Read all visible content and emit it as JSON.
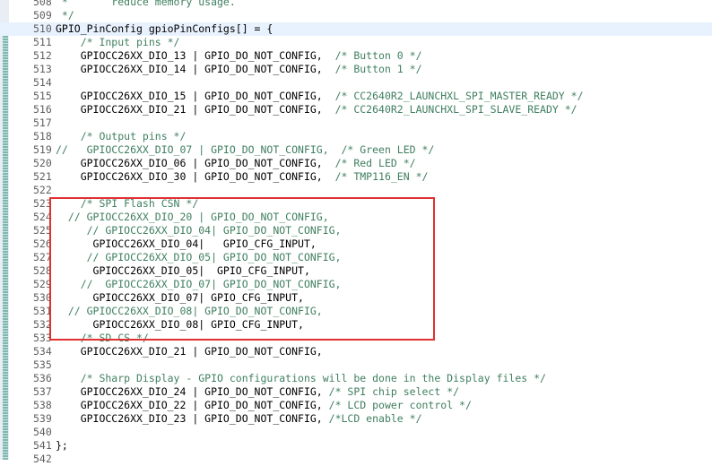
{
  "editor": {
    "lines": [
      {
        "n": "508",
        "segs": [
          {
            "t": " *       reduce memory usage.",
            "k": "c"
          }
        ]
      },
      {
        "n": "509",
        "segs": [
          {
            "t": " */",
            "k": "c"
          }
        ]
      },
      {
        "n": "510",
        "segs": [
          {
            "t": "GPIO_PinConfig gpioPinConfigs[] = {",
            "k": "n"
          }
        ]
      },
      {
        "n": "511",
        "segs": [
          {
            "t": "    /* Input pins */",
            "k": "c"
          }
        ]
      },
      {
        "n": "512",
        "segs": [
          {
            "t": "    GPIOCC26XX_DIO_13 | GPIO_DO_NOT_CONFIG,  ",
            "k": "n"
          },
          {
            "t": "/* Button 0 */",
            "k": "c"
          }
        ]
      },
      {
        "n": "513",
        "segs": [
          {
            "t": "    GPIOCC26XX_DIO_14 | GPIO_DO_NOT_CONFIG,  ",
            "k": "n"
          },
          {
            "t": "/* Button 1 */",
            "k": "c"
          }
        ]
      },
      {
        "n": "514",
        "segs": []
      },
      {
        "n": "515",
        "segs": [
          {
            "t": "    GPIOCC26XX_DIO_15 | GPIO_DO_NOT_CONFIG,  ",
            "k": "n"
          },
          {
            "t": "/* CC2640R2_LAUNCHXL_SPI_MASTER_READY */",
            "k": "c"
          }
        ]
      },
      {
        "n": "516",
        "segs": [
          {
            "t": "    GPIOCC26XX_DIO_21 | GPIO_DO_NOT_CONFIG,  ",
            "k": "n"
          },
          {
            "t": "/* CC2640R2_LAUNCHXL_SPI_SLAVE_READY */",
            "k": "c"
          }
        ]
      },
      {
        "n": "517",
        "segs": []
      },
      {
        "n": "518",
        "segs": [
          {
            "t": "    /* Output pins */",
            "k": "c"
          }
        ]
      },
      {
        "n": "519",
        "segs": [
          {
            "t": "//   GPIOCC26XX_DIO_07 | GPIO_DO_NOT_CONFIG,  /* Green LED */",
            "k": "c"
          }
        ]
      },
      {
        "n": "520",
        "segs": [
          {
            "t": "    GPIOCC26XX_DIO_06 | GPIO_DO_NOT_CONFIG,  ",
            "k": "n"
          },
          {
            "t": "/* Red LED */",
            "k": "c"
          }
        ]
      },
      {
        "n": "521",
        "segs": [
          {
            "t": "    GPIOCC26XX_DIO_30 | GPIO_DO_NOT_CONFIG,  ",
            "k": "n"
          },
          {
            "t": "/* TMP116_EN */",
            "k": "c"
          }
        ]
      },
      {
        "n": "522",
        "segs": []
      },
      {
        "n": "523",
        "segs": [
          {
            "t": "    /* SPI Flash CSN */",
            "k": "c"
          }
        ]
      },
      {
        "n": "524",
        "segs": [
          {
            "t": "  // GPIOCC26XX_DIO_20 | GPIO_DO_NOT_CONFIG,",
            "k": "c"
          }
        ]
      },
      {
        "n": "525",
        "segs": [
          {
            "t": "     // GPIOCC26XX_DIO_04| GPIO_DO_NOT_CONFIG,",
            "k": "c"
          }
        ]
      },
      {
        "n": "526",
        "segs": [
          {
            "t": "      GPIOCC26XX_DIO_04|   GPIO_CFG_INPUT,",
            "k": "n"
          }
        ]
      },
      {
        "n": "527",
        "segs": [
          {
            "t": "     // GPIOCC26XX_DIO_05| GPIO_DO_NOT_CONFIG,",
            "k": "c"
          }
        ]
      },
      {
        "n": "528",
        "segs": [
          {
            "t": "      GPIOCC26XX_DIO_05|  GPIO_CFG_INPUT,",
            "k": "n"
          }
        ]
      },
      {
        "n": "529",
        "segs": [
          {
            "t": "    //  GPIOCC26XX_DIO_07| GPIO_DO_NOT_CONFIG,",
            "k": "c"
          }
        ]
      },
      {
        "n": "530",
        "segs": [
          {
            "t": "      GPIOCC26XX_DIO_07| GPIO_CFG_INPUT,",
            "k": "n"
          }
        ]
      },
      {
        "n": "531",
        "segs": [
          {
            "t": "  // GPIOCC26XX_DIO_08| GPIO_DO_NOT_CONFIG,",
            "k": "c"
          }
        ]
      },
      {
        "n": "532",
        "segs": [
          {
            "t": "      GPIOCC26XX_DIO_08| GPIO_CFG_INPUT,",
            "k": "n"
          }
        ]
      },
      {
        "n": "533",
        "segs": [
          {
            "t": "    /* SD CS */",
            "k": "c"
          }
        ]
      },
      {
        "n": "534",
        "segs": [
          {
            "t": "    GPIOCC26XX_DIO_21 | GPIO_DO_NOT_CONFIG,",
            "k": "n"
          }
        ]
      },
      {
        "n": "535",
        "segs": []
      },
      {
        "n": "536",
        "segs": [
          {
            "t": "    /* Sharp Display - GPIO configurations will be done in the Display files */",
            "k": "c"
          }
        ]
      },
      {
        "n": "537",
        "segs": [
          {
            "t": "    GPIOCC26XX_DIO_24 | GPIO_DO_NOT_CONFIG, ",
            "k": "n"
          },
          {
            "t": "/* SPI chip select */",
            "k": "c"
          }
        ]
      },
      {
        "n": "538",
        "segs": [
          {
            "t": "    GPIOCC26XX_DIO_22 | GPIO_DO_NOT_CONFIG, ",
            "k": "n"
          },
          {
            "t": "/* LCD power control */",
            "k": "c"
          }
        ]
      },
      {
        "n": "539",
        "segs": [
          {
            "t": "    GPIOCC26XX_DIO_23 | GPIO_DO_NOT_CONFIG, ",
            "k": "n"
          },
          {
            "t": "/*LCD enable */",
            "k": "c"
          }
        ]
      },
      {
        "n": "540",
        "segs": []
      },
      {
        "n": "541",
        "segs": [
          {
            "t": "};",
            "k": "n"
          }
        ]
      },
      {
        "n": "542",
        "segs": []
      }
    ],
    "colors": {
      "comment": "#3f7f5f",
      "code": "#000000",
      "line_number": "#5f5f5f",
      "highlight_box": "#e03030"
    }
  }
}
